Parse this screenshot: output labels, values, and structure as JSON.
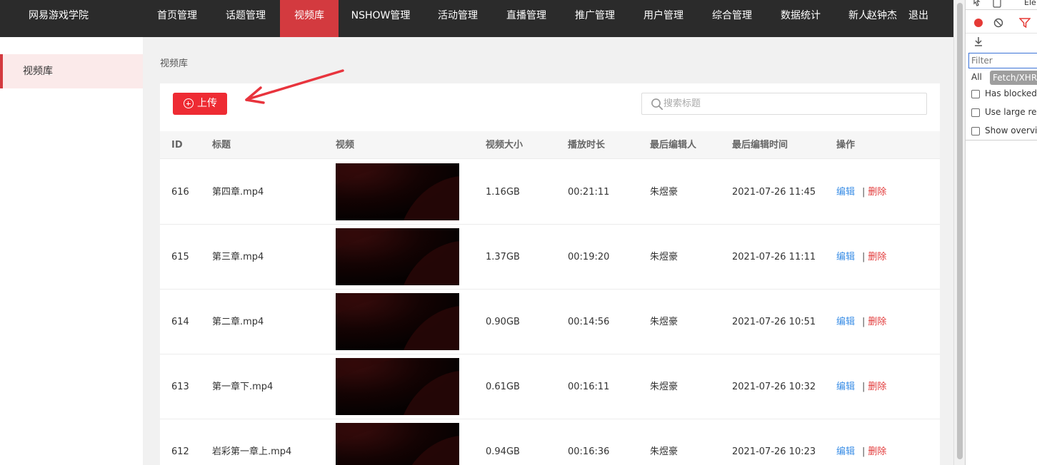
{
  "header": {
    "brand": "网易游戏学院",
    "nav": [
      {
        "label": "首页管理"
      },
      {
        "label": "话题管理"
      },
      {
        "label": "视频库"
      },
      {
        "label": "NSHOW管理"
      },
      {
        "label": "活动管理"
      },
      {
        "label": "直播管理"
      },
      {
        "label": "推广管理"
      },
      {
        "label": "用户管理"
      },
      {
        "label": "综合管理"
      },
      {
        "label": "数据统计"
      },
      {
        "label": "新人..."
      }
    ],
    "active_nav": "视频库",
    "user": "赵钟杰",
    "logout": "退出"
  },
  "sidebar": {
    "items": [
      {
        "label": "视频库"
      }
    ]
  },
  "breadcrumb": "视频库",
  "toolbar": {
    "upload_label": "上传",
    "search_placeholder": "搜索标题"
  },
  "table": {
    "columns": [
      "ID",
      "标题",
      "视频",
      "视频大小",
      "播放时长",
      "最后编辑人",
      "最后编辑时间",
      "操作"
    ],
    "rows": [
      {
        "id": "616",
        "title": "第四章.mp4",
        "size": "1.16GB",
        "duration": "00:21:11",
        "editor": "朱煜豪",
        "time": "2021-07-26 11:45",
        "edit": "编辑",
        "sep": "|",
        "delete": "删除"
      },
      {
        "id": "615",
        "title": "第三章.mp4",
        "size": "1.37GB",
        "duration": "00:19:20",
        "editor": "朱煜豪",
        "time": "2021-07-26 11:11",
        "edit": "编辑",
        "sep": "|",
        "delete": "删除"
      },
      {
        "id": "614",
        "title": "第二章.mp4",
        "size": "0.90GB",
        "duration": "00:14:56",
        "editor": "朱煜豪",
        "time": "2021-07-26 10:51",
        "edit": "编辑",
        "sep": "|",
        "delete": "删除"
      },
      {
        "id": "613",
        "title": "第一章下.mp4",
        "size": "0.61GB",
        "duration": "00:16:11",
        "editor": "朱煜豪",
        "time": "2021-07-26 10:32",
        "edit": "编辑",
        "sep": "|",
        "delete": "删除"
      },
      {
        "id": "612",
        "title": "岩彩第一章上.mp4",
        "size": "0.94GB",
        "duration": "00:16:36",
        "editor": "朱煜豪",
        "time": "2021-07-26 10:23",
        "edit": "编辑",
        "sep": "|",
        "delete": "删除"
      }
    ]
  },
  "colors": {
    "topbar": "#2b2b2b",
    "accent": "#d33a3f",
    "upload_button": "#ee2b33",
    "edit_link": "#3a8ee6",
    "delete_link": "#e23a3a",
    "annotation_arrow": "#e8343d"
  },
  "devtools": {
    "tab_partial": "Ele",
    "filter_placeholder": "Filter",
    "type_all": "All",
    "type_fetch": "Fetch/XHR",
    "checks": [
      {
        "label": "Has blocked c"
      },
      {
        "label": "Use large requ"
      },
      {
        "label": "Show overview"
      }
    ],
    "icons": [
      "inspect-icon",
      "device-icon",
      "record-icon",
      "clear-icon",
      "filter-icon",
      "download-icon"
    ]
  }
}
